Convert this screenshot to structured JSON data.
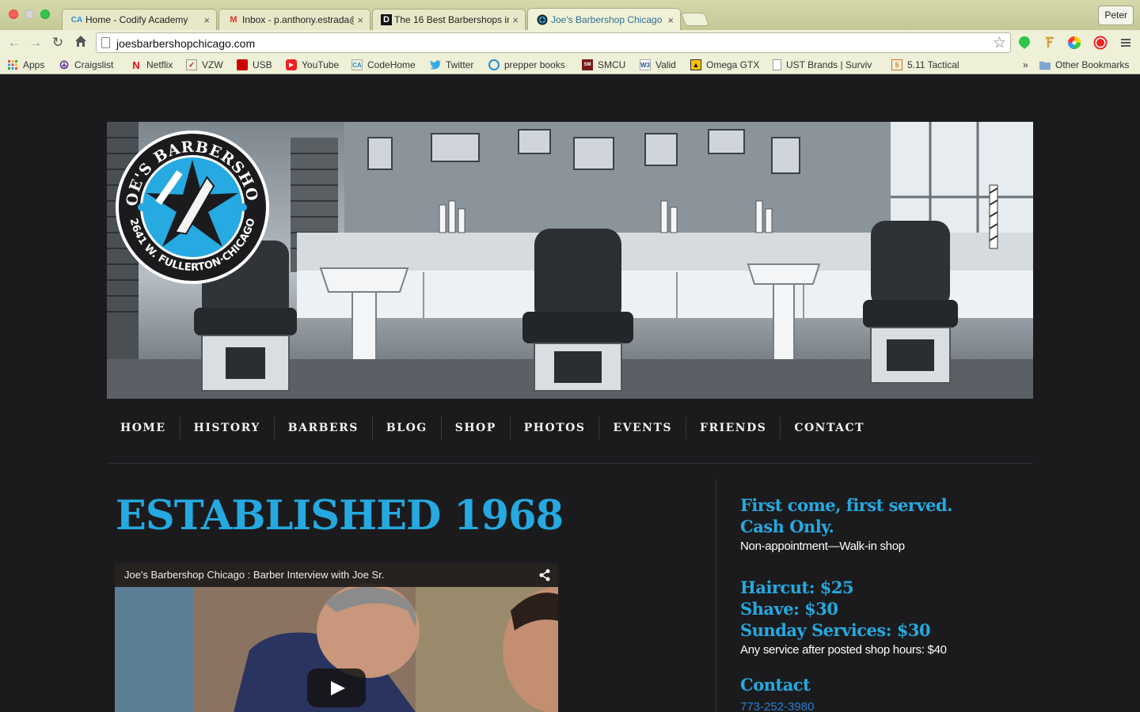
{
  "browser": {
    "tabs": [
      {
        "label": "Home - Codify Academy",
        "icon": "codify-favicon"
      },
      {
        "label": "Inbox - p.anthony.estrada@",
        "icon": "gmail-favicon"
      },
      {
        "label": "The 16 Best Barbershops in",
        "icon": "d-favicon"
      },
      {
        "label": "Joe's Barbershop Chicago",
        "icon": "joes-favicon",
        "active": true
      }
    ],
    "tab_close": "×",
    "profile": "Peter",
    "url": "joesbarbershopchicago.com",
    "bookmarks": [
      {
        "label": "Apps",
        "icon": "apps-grid-icon"
      },
      {
        "label": "Craigslist",
        "icon": "peace-icon"
      },
      {
        "label": "Netflix",
        "icon": "netflix-icon"
      },
      {
        "label": "VZW",
        "icon": "vzw-icon"
      },
      {
        "label": "USB",
        "icon": "usb-icon"
      },
      {
        "label": "YouTube",
        "icon": "youtube-icon"
      },
      {
        "label": "CodeHome",
        "icon": "codify-icon"
      },
      {
        "label": "Twitter",
        "icon": "twitter-icon"
      },
      {
        "label": "prepper books",
        "icon": "prepper-icon"
      },
      {
        "label": "SMCU",
        "icon": "smcu-icon"
      },
      {
        "label": "Valid",
        "icon": "w3-icon"
      },
      {
        "label": "Omega GTX",
        "icon": "omega-icon"
      },
      {
        "label": "UST Brands | Surviv",
        "icon": "page-icon"
      },
      {
        "label": "5.11 Tactical",
        "icon": "tactical-icon"
      }
    ],
    "overflow_chevron": "»",
    "other_bookmarks": "Other Bookmarks"
  },
  "logo": {
    "top_text": "JOE'S BARBERSHOP",
    "bottom_text": "2641 W. FULLERTON·CHICAGO"
  },
  "nav": [
    "HOME",
    "HISTORY",
    "BARBERS",
    "BLOG",
    "SHOP",
    "PHOTOS",
    "EVENTS",
    "FRIENDS",
    "CONTACT"
  ],
  "main": {
    "heading": "ESTABLISHED 1968",
    "video_title": "Joe's Barbershop Chicago : Barber Interview with Joe Sr."
  },
  "sidebar": {
    "policy_line1": "First come, first served.",
    "policy_line2": "Cash Only.",
    "policy_note": "Non-appointment—Walk-in shop",
    "price_haircut": "Haircut: $25",
    "price_shave": "Shave: $30",
    "price_sunday": "Sunday Services: $30",
    "after_hours": "Any service after posted shop hours: $40",
    "contact_heading": "Contact",
    "phone": "773-252-3980"
  },
  "colors": {
    "accent": "#25a9e0",
    "page_bg": "#1b1b1d",
    "link": "#2a7fd4",
    "chrome": "#eef0d8"
  }
}
